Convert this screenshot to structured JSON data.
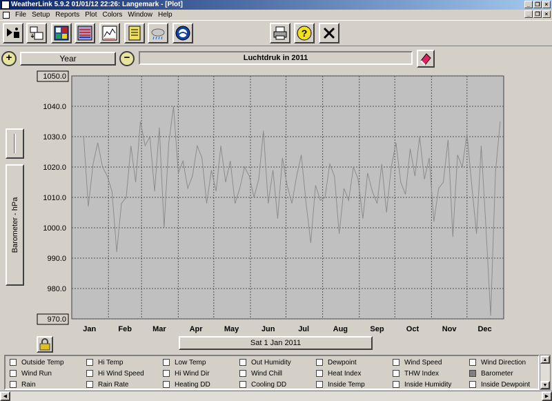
{
  "window": {
    "title": "WeatherLink 5.9.2  01/01/12  22:26: Langemark - [Plot]"
  },
  "menu": [
    "File",
    "Setup",
    "Reports",
    "Plot",
    "Colors",
    "Window",
    "Help"
  ],
  "toolbar": {
    "buttons": [
      "select-station-icon",
      "download-icon",
      "bulletin-icon",
      "summary-icon",
      "strip-chart-icon",
      "notebook-icon",
      "weather-icon",
      "noaa-icon",
      "print-icon",
      "help-icon",
      "close-icon"
    ]
  },
  "nav": {
    "period": "Year",
    "plot_title": "Luchtdruk  in 2011",
    "date": "Sat 1 Jan 2011"
  },
  "colors": {
    "plot_bg": "#c0c0c0",
    "line": "#8c8c8c",
    "grid": "#505050"
  },
  "chart_data": {
    "type": "line",
    "title": "Luchtdruk  in 2011",
    "ylabel": "Barometer - hPa",
    "ylim": [
      970,
      1050
    ],
    "yticks": [
      "1050.0",
      "1040.0",
      "1030.0",
      "1020.0",
      "1010.0",
      "1000.0",
      "990.0",
      "980.0",
      "970.0"
    ],
    "xticks": [
      "Jan",
      "Feb",
      "Mar",
      "Apr",
      "May",
      "Jun",
      "Jul",
      "Aug",
      "Sep",
      "Oct",
      "Nov",
      "Dec"
    ],
    "grid": true,
    "series": [
      {
        "x": [
          10,
          14,
          18,
          22,
          26,
          30,
          34,
          38,
          42,
          46,
          50,
          54,
          58,
          62,
          66,
          70,
          74,
          78,
          82,
          86,
          90,
          94,
          98,
          102,
          106,
          110,
          114,
          118,
          122,
          126,
          130,
          134,
          138,
          142,
          146,
          150,
          154,
          158,
          162,
          166,
          170,
          174,
          178,
          182,
          186,
          190,
          194,
          198,
          202,
          206,
          210,
          214,
          218,
          222,
          226,
          230,
          234,
          238,
          242,
          246,
          250,
          254,
          258,
          262,
          266,
          270,
          274,
          278,
          282,
          286,
          290,
          294,
          298,
          302,
          306,
          310,
          314,
          318,
          322,
          326,
          330,
          334,
          338,
          342,
          346,
          350,
          354,
          358,
          362
        ],
        "values": [
          1030,
          1007,
          1021,
          1028,
          1020,
          1017,
          1012,
          992,
          1008,
          1010,
          1027,
          1015,
          1035,
          1027,
          1030,
          1012,
          1033,
          1000,
          1028,
          1040,
          1018,
          1022,
          1013,
          1017,
          1027,
          1023,
          1008,
          1019,
          1012,
          1027,
          1015,
          1022,
          1008,
          1013,
          1020,
          1017,
          1010,
          1016,
          1032,
          1008,
          1019,
          1003,
          1023,
          1014,
          1008,
          1017,
          1024,
          1008,
          995,
          1014,
          1009,
          1010,
          1021,
          1017,
          998,
          1013,
          1009,
          1020,
          1016,
          1003,
          1018,
          1012,
          1008,
          1021,
          1005,
          1020,
          1028,
          1015,
          1011,
          1026,
          1017,
          1030,
          1016,
          1023,
          1002,
          1013,
          1015,
          1029,
          997,
          1024,
          1020,
          1031,
          1014,
          998,
          1027,
          1000,
          971,
          1018,
          1035
        ]
      }
    ]
  },
  "legend": {
    "items": [
      {
        "label": "Outside Temp",
        "checked": false
      },
      {
        "label": "Hi Temp",
        "checked": false
      },
      {
        "label": "Low Temp",
        "checked": false
      },
      {
        "label": "Out Humidity",
        "checked": false
      },
      {
        "label": "Dewpoint",
        "checked": false
      },
      {
        "label": "Wind Speed",
        "checked": false
      },
      {
        "label": "Wind Direction",
        "checked": false
      },
      {
        "label": "Wind Run",
        "checked": false
      },
      {
        "label": "Hi Wind Speed",
        "checked": false
      },
      {
        "label": "Hi Wind Dir",
        "checked": false
      },
      {
        "label": "Wind Chill",
        "checked": false
      },
      {
        "label": "Heat Index",
        "checked": false
      },
      {
        "label": "THW Index",
        "checked": false
      },
      {
        "label": "Barometer",
        "checked": true
      },
      {
        "label": "Rain",
        "checked": false
      },
      {
        "label": "Rain Rate",
        "checked": false
      },
      {
        "label": "Heating DD",
        "checked": false
      },
      {
        "label": "Cooling DD",
        "checked": false
      },
      {
        "label": "Inside Temp",
        "checked": false
      },
      {
        "label": "Inside Humidity",
        "checked": false
      },
      {
        "label": "Inside Dewpoint",
        "checked": false
      }
    ]
  }
}
